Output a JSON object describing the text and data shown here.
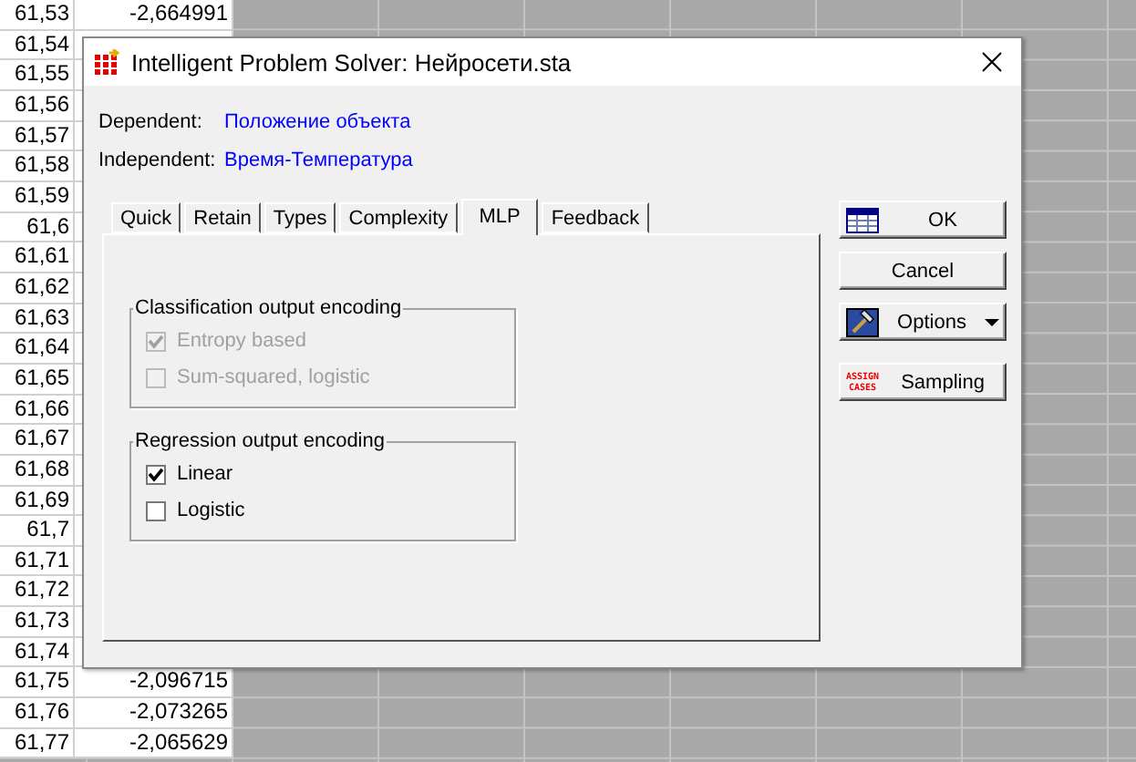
{
  "sheet": {
    "rows": [
      {
        "a": "61,53",
        "b": "-2,664991"
      },
      {
        "a": "61,54"
      },
      {
        "a": "61,55"
      },
      {
        "a": "61,56"
      },
      {
        "a": "61,57"
      },
      {
        "a": "61,58"
      },
      {
        "a": "61,59"
      },
      {
        "a": "61,6"
      },
      {
        "a": "61,61"
      },
      {
        "a": "61,62"
      },
      {
        "a": "61,63"
      },
      {
        "a": "61,64"
      },
      {
        "a": "61,65"
      },
      {
        "a": "61,66"
      },
      {
        "a": "61,67"
      },
      {
        "a": "61,68"
      },
      {
        "a": "61,69"
      },
      {
        "a": "61,7"
      },
      {
        "a": "61,71"
      },
      {
        "a": "61,72"
      },
      {
        "a": "61,73"
      },
      {
        "a": "61,74"
      },
      {
        "a": "61,75",
        "b": "-2,096715"
      },
      {
        "a": "61,76",
        "b": "-2,073265"
      },
      {
        "a": "61,77",
        "b": "-2,065629"
      }
    ]
  },
  "dialog": {
    "title": "Intelligent Problem Solver: Нейросети.sta",
    "fields": [
      {
        "label": "Dependent:",
        "value": "Положение объекта"
      },
      {
        "label": "Independent:",
        "value": "Время-Температура"
      }
    ],
    "tabs": [
      {
        "label": "Quick",
        "selected": false
      },
      {
        "label": "Retain",
        "selected": false
      },
      {
        "label": "Types",
        "selected": false
      },
      {
        "label": "Complexity",
        "selected": false
      },
      {
        "label": "MLP",
        "selected": true
      },
      {
        "label": "Feedback",
        "selected": false
      }
    ],
    "groups": [
      {
        "title": "Classification output encoding",
        "options": [
          {
            "label": "Entropy based",
            "checked": true,
            "disabled": true
          },
          {
            "label": "Sum-squared, logistic",
            "checked": false,
            "disabled": true
          }
        ]
      },
      {
        "title": "Regression output encoding",
        "options": [
          {
            "label": "Linear",
            "checked": true,
            "disabled": false
          },
          {
            "label": "Logistic",
            "checked": false,
            "disabled": false
          }
        ]
      }
    ],
    "buttons": [
      {
        "kind": "table",
        "label": "OK"
      },
      {
        "kind": "plain",
        "label": "Cancel"
      },
      {
        "kind": "menu",
        "label": "Options"
      },
      {
        "kind": "assign",
        "label": "Sampling",
        "icon_text": [
          "ASSIGN",
          "CASES"
        ]
      }
    ]
  }
}
